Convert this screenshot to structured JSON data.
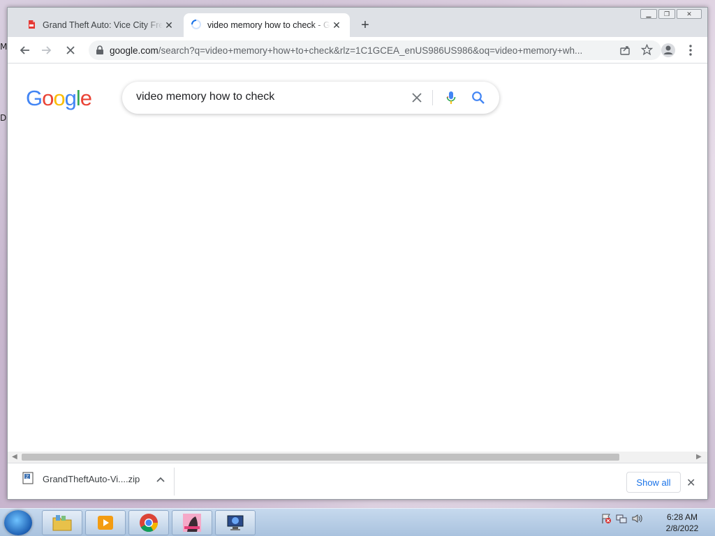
{
  "browser": {
    "tabs": [
      {
        "title": "Grand Theft Auto: Vice City Free Download",
        "active": false
      },
      {
        "title": "video memory how to check - Google Search",
        "active": true
      }
    ],
    "url_host": "google.com",
    "url_path": "/search?q=video+memory+how+to+check&rlz=1C1GCEA_enUS986US986&oq=video+memory+wh..."
  },
  "google": {
    "logo": [
      "G",
      "o",
      "o",
      "g",
      "l",
      "e"
    ],
    "query": "video memory how to check"
  },
  "downloads": {
    "item_name": "GrandTheftAuto-Vi....zip",
    "show_all_label": "Show all"
  },
  "desktop": {
    "left_edge_letters": [
      "M",
      "D"
    ]
  },
  "taskbar": {
    "time": "6:28 AM",
    "date": "2/8/2022"
  },
  "colors": {
    "google_blue": "#4285f4",
    "google_red": "#ea4335",
    "google_yellow": "#fbbc05",
    "google_green": "#34a853",
    "link_blue": "#1a73e8"
  },
  "icons": [
    "pdf-icon",
    "loading-spinner-icon",
    "close-icon",
    "plus-icon",
    "back-arrow-icon",
    "forward-arrow-icon",
    "stop-icon",
    "lock-icon",
    "share-icon",
    "star-icon",
    "profile-icon",
    "kebab-menu-icon",
    "clear-icon",
    "mic-icon",
    "search-icon",
    "zip-file-icon",
    "chevron-up-icon",
    "start-orb-icon",
    "explorer-icon",
    "media-player-icon",
    "chrome-icon",
    "game-icon",
    "app-icon",
    "flag-icon",
    "network-icon",
    "volume-icon"
  ]
}
